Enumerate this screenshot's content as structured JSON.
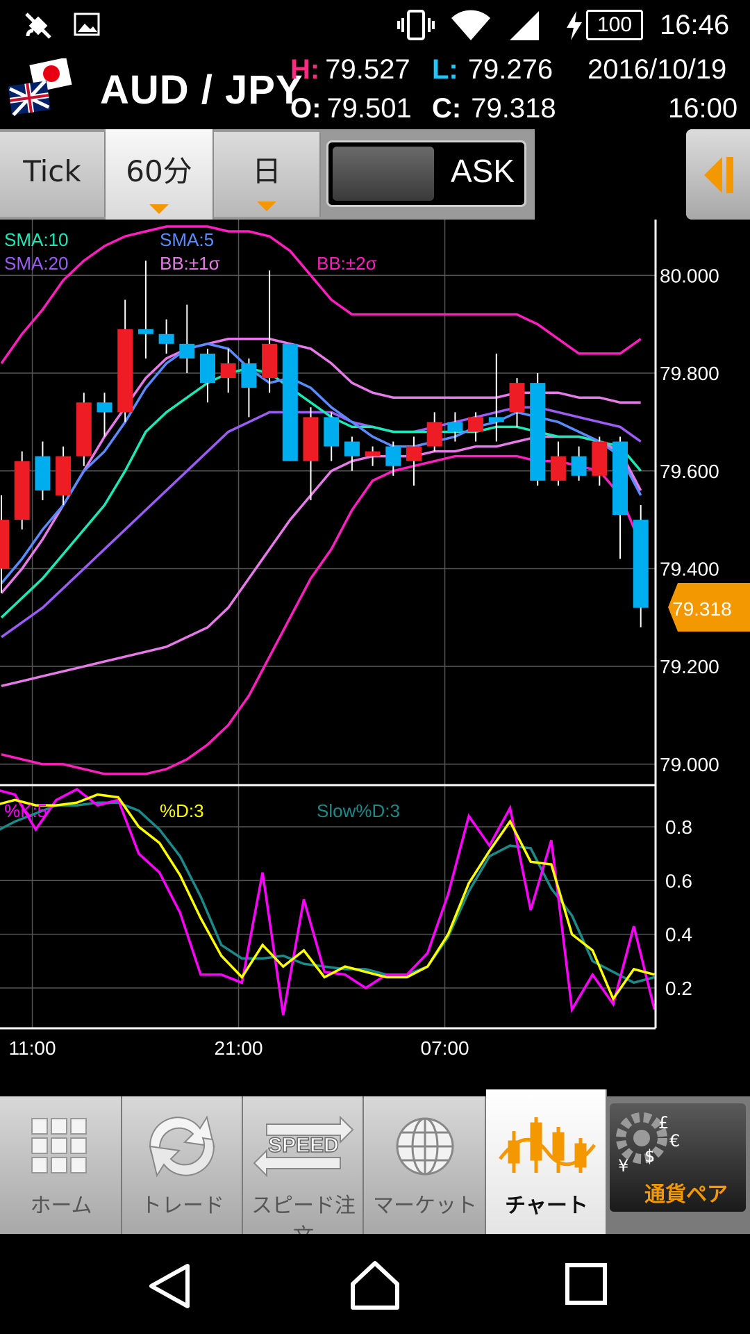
{
  "status_bar": {
    "battery": "100",
    "time": "16:46"
  },
  "header": {
    "pair": "AUD / JPY",
    "high_label": "H:",
    "high": "79.527",
    "low_label": "L:",
    "low": "79.276",
    "open_label": "O:",
    "open": "79.501",
    "close_label": "C:",
    "close": "79.318",
    "date": "2016/10/19",
    "time": "16:00"
  },
  "tabs": [
    {
      "label": "Tick",
      "active": false,
      "has_dropdown": false
    },
    {
      "label": "60分",
      "active": true,
      "has_dropdown": true
    },
    {
      "label": "日",
      "active": false,
      "has_dropdown": true
    }
  ],
  "toggle": {
    "label": "ASK"
  },
  "chart": {
    "legend": {
      "sma10": "SMA:10",
      "sma5": "SMA:5",
      "sma20": "SMA:20",
      "bb1": "BB:±1σ",
      "bb2": "BB:±2σ"
    },
    "colors": {
      "bull": "#ee1c25",
      "bear": "#00aeef",
      "sma5": "#5b8cff",
      "sma10": "#1de9b6",
      "sma20": "#9c5cf5",
      "bb1": "#e67ae8",
      "bb2": "#ff1fbf"
    },
    "y_ticks": [
      "80.000",
      "79.800",
      "79.600",
      "79.400",
      "79.200",
      "79.000"
    ],
    "y_tick_values": [
      80.0,
      79.8,
      79.6,
      79.4,
      79.2,
      79.0
    ],
    "price_tag": "79.318",
    "x_ticks": [
      "11:00",
      "21:00",
      "07:00"
    ]
  },
  "stoch": {
    "legend": {
      "k": "%K:5",
      "d": "%D:3",
      "slowd": "Slow%D:3"
    },
    "colors": {
      "k": "#ff00ff",
      "d": "#ffff00",
      "slowd": "#1a8a8a"
    },
    "y_ticks": [
      "0.8",
      "0.6",
      "0.4",
      "0.2"
    ],
    "y_tick_values": [
      0.8,
      0.6,
      0.4,
      0.2
    ]
  },
  "chart_data": {
    "type": "candlestick",
    "ylim": [
      78.96,
      80.1
    ],
    "candles": [
      {
        "o": 79.4,
        "c": 79.5,
        "h": 79.55,
        "l": 79.35
      },
      {
        "o": 79.5,
        "c": 79.62,
        "h": 79.64,
        "l": 79.48
      },
      {
        "o": 79.63,
        "c": 79.56,
        "h": 79.66,
        "l": 79.54
      },
      {
        "o": 79.55,
        "c": 79.63,
        "h": 79.65,
        "l": 79.53
      },
      {
        "o": 79.63,
        "c": 79.74,
        "h": 79.76,
        "l": 79.61
      },
      {
        "o": 79.74,
        "c": 79.72,
        "h": 79.76,
        "l": 79.67
      },
      {
        "o": 79.72,
        "c": 79.89,
        "h": 79.95,
        "l": 79.7
      },
      {
        "o": 79.89,
        "c": 79.88,
        "h": 80.03,
        "l": 79.83
      },
      {
        "o": 79.88,
        "c": 79.86,
        "h": 79.91,
        "l": 79.84
      },
      {
        "o": 79.86,
        "c": 79.83,
        "h": 79.94,
        "l": 79.8
      },
      {
        "o": 79.84,
        "c": 79.78,
        "h": 79.85,
        "l": 79.74
      },
      {
        "o": 79.79,
        "c": 79.82,
        "h": 79.85,
        "l": 79.76
      },
      {
        "o": 79.82,
        "c": 79.77,
        "h": 79.83,
        "l": 79.71
      },
      {
        "o": 79.79,
        "c": 79.86,
        "h": 80.01,
        "l": 79.76
      },
      {
        "o": 79.86,
        "c": 79.62,
        "h": 79.86,
        "l": 79.62
      },
      {
        "o": 79.62,
        "c": 79.71,
        "h": 79.73,
        "l": 79.54
      },
      {
        "o": 79.71,
        "c": 79.65,
        "h": 79.72,
        "l": 79.62
      },
      {
        "o": 79.66,
        "c": 79.63,
        "h": 79.67,
        "l": 79.6
      },
      {
        "o": 79.63,
        "c": 79.64,
        "h": 79.65,
        "l": 79.61
      },
      {
        "o": 79.65,
        "c": 79.61,
        "h": 79.66,
        "l": 79.59
      },
      {
        "o": 79.62,
        "c": 79.65,
        "h": 79.67,
        "l": 79.57
      },
      {
        "o": 79.65,
        "c": 79.7,
        "h": 79.72,
        "l": 79.64
      },
      {
        "o": 79.7,
        "c": 79.68,
        "h": 79.72,
        "l": 79.66
      },
      {
        "o": 79.68,
        "c": 79.71,
        "h": 79.72,
        "l": 79.66
      },
      {
        "o": 79.71,
        "c": 79.7,
        "h": 79.84,
        "l": 79.66
      },
      {
        "o": 79.72,
        "c": 79.78,
        "h": 79.79,
        "l": 79.69
      },
      {
        "o": 79.78,
        "c": 79.58,
        "h": 79.8,
        "l": 79.57
      },
      {
        "o": 79.58,
        "c": 79.63,
        "h": 79.66,
        "l": 79.57
      },
      {
        "o": 79.63,
        "c": 79.59,
        "h": 79.65,
        "l": 79.58
      },
      {
        "o": 79.59,
        "c": 79.66,
        "h": 79.67,
        "l": 79.57
      },
      {
        "o": 79.66,
        "c": 79.51,
        "h": 79.67,
        "l": 79.42
      },
      {
        "o": 79.5,
        "c": 79.32,
        "h": 79.53,
        "l": 79.28
      }
    ],
    "sma5": [
      79.37,
      79.42,
      79.48,
      79.53,
      79.6,
      79.64,
      79.7,
      79.77,
      79.82,
      79.85,
      79.86,
      79.85,
      79.81,
      79.78,
      79.79,
      79.77,
      79.73,
      79.7,
      79.67,
      79.65,
      79.65,
      79.66,
      79.67,
      79.69,
      79.7,
      79.72,
      79.71,
      79.7,
      79.68,
      79.66,
      79.63,
      79.55
    ],
    "sma10": [
      79.3,
      79.34,
      79.38,
      79.43,
      79.48,
      79.53,
      79.6,
      79.68,
      79.72,
      79.75,
      79.78,
      79.8,
      79.81,
      79.8,
      79.77,
      79.74,
      79.71,
      79.69,
      79.69,
      79.68,
      79.68,
      79.68,
      79.68,
      79.68,
      79.69,
      79.69,
      79.68,
      79.67,
      79.67,
      79.66,
      79.65,
      79.6
    ],
    "sma20": [
      79.26,
      79.29,
      79.32,
      79.36,
      79.4,
      79.44,
      79.48,
      79.52,
      79.56,
      79.6,
      79.64,
      79.68,
      79.7,
      79.72,
      79.72,
      79.72,
      79.72,
      79.7,
      79.69,
      79.68,
      79.68,
      79.69,
      79.7,
      79.71,
      79.72,
      79.73,
      79.73,
      79.72,
      79.71,
      79.7,
      79.69,
      79.66
    ],
    "bb_u1": [
      79.35,
      79.4,
      79.46,
      79.53,
      79.6,
      79.67,
      79.73,
      79.79,
      79.83,
      79.85,
      79.86,
      79.87,
      79.87,
      79.87,
      79.86,
      79.85,
      79.82,
      79.78,
      79.76,
      79.75,
      79.75,
      79.75,
      79.75,
      79.75,
      79.75,
      79.76,
      79.76,
      79.76,
      79.75,
      79.75,
      79.74,
      79.74
    ],
    "bb_l1": [
      79.16,
      79.17,
      79.18,
      79.19,
      79.2,
      79.21,
      79.22,
      79.23,
      79.24,
      79.26,
      79.28,
      79.32,
      79.38,
      79.44,
      79.5,
      79.55,
      79.6,
      79.62,
      79.63,
      79.63,
      79.63,
      79.64,
      79.64,
      79.65,
      79.65,
      79.66,
      79.67,
      79.67,
      79.67,
      79.66,
      79.64,
      79.56
    ],
    "bb_u2": [
      79.82,
      79.88,
      79.93,
      79.99,
      80.03,
      80.06,
      80.08,
      80.09,
      80.1,
      80.1,
      80.1,
      80.09,
      80.09,
      80.08,
      80.05,
      80.0,
      79.95,
      79.92,
      79.92,
      79.92,
      79.92,
      79.92,
      79.92,
      79.92,
      79.92,
      79.92,
      79.9,
      79.87,
      79.84,
      79.84,
      79.84,
      79.87
    ],
    "bb_l2": [
      79.02,
      79.01,
      79.0,
      79.0,
      78.99,
      78.98,
      78.98,
      78.98,
      78.99,
      79.01,
      79.04,
      79.08,
      79.14,
      79.22,
      79.3,
      79.38,
      79.44,
      79.52,
      79.58,
      79.6,
      79.61,
      79.62,
      79.63,
      79.63,
      79.63,
      79.63,
      79.62,
      79.62,
      79.61,
      79.6,
      79.55,
      79.45
    ],
    "stoch_ylim": [
      0.05,
      0.95
    ],
    "stoch_k": [
      0.94,
      0.92,
      0.79,
      0.9,
      0.94,
      0.88,
      0.9,
      0.7,
      0.63,
      0.48,
      0.25,
      0.25,
      0.22,
      0.63,
      0.1,
      0.53,
      0.26,
      0.25,
      0.2,
      0.25,
      0.25,
      0.33,
      0.55,
      0.84,
      0.73,
      0.87,
      0.49,
      0.75,
      0.12,
      0.25,
      0.14,
      0.43,
      0.12
    ],
    "stoch_d": [
      0.88,
      0.9,
      0.88,
      0.88,
      0.89,
      0.92,
      0.91,
      0.8,
      0.74,
      0.62,
      0.46,
      0.32,
      0.24,
      0.36,
      0.28,
      0.34,
      0.24,
      0.28,
      0.26,
      0.24,
      0.24,
      0.28,
      0.4,
      0.59,
      0.71,
      0.82,
      0.67,
      0.66,
      0.4,
      0.34,
      0.16,
      0.27,
      0.25
    ],
    "stoch_slowd": [
      0.78,
      0.82,
      0.85,
      0.88,
      0.88,
      0.89,
      0.89,
      0.86,
      0.79,
      0.69,
      0.54,
      0.36,
      0.31,
      0.31,
      0.32,
      0.29,
      0.28,
      0.27,
      0.27,
      0.25,
      0.25,
      0.28,
      0.39,
      0.56,
      0.69,
      0.73,
      0.72,
      0.57,
      0.47,
      0.3,
      0.26,
      0.22,
      0.24
    ]
  },
  "nav": [
    {
      "label": "ホーム",
      "icon": "home-grid-icon",
      "active": false
    },
    {
      "label": "トレード",
      "icon": "trade-arrows-icon",
      "active": false
    },
    {
      "label": "スピード注文",
      "icon": "speed-order-icon",
      "active": false
    },
    {
      "label": "マーケット",
      "icon": "globe-icon",
      "active": false
    },
    {
      "label": "チャート",
      "icon": "chart-icon",
      "active": true
    }
  ],
  "currency_pair_button": {
    "label": "通貨ペア"
  }
}
